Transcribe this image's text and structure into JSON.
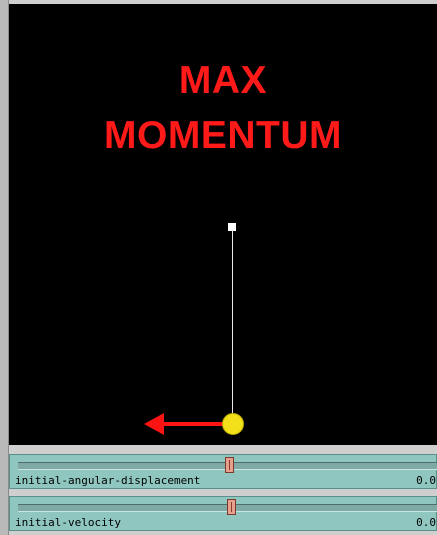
{
  "canvas": {
    "title_line1": "MAX",
    "title_line2": "MOMENTUM",
    "icons": {
      "pivot": "pivot-point-icon",
      "bob": "pendulum-bob-icon",
      "arrow": "velocity-arrow-icon"
    },
    "colors": {
      "background": "#000000",
      "title": "#ff1a1a",
      "bob": "#f2e01a",
      "arrow": "#ff1414",
      "rod": "#e8e8e8"
    }
  },
  "sliders": [
    {
      "label": "initial-angular-displacement",
      "value": "0.0"
    },
    {
      "label": "initial-velocity",
      "value": "0.0"
    }
  ],
  "slider_colors": {
    "background": "#8fc7c0",
    "thumb": "#e7a08e"
  }
}
